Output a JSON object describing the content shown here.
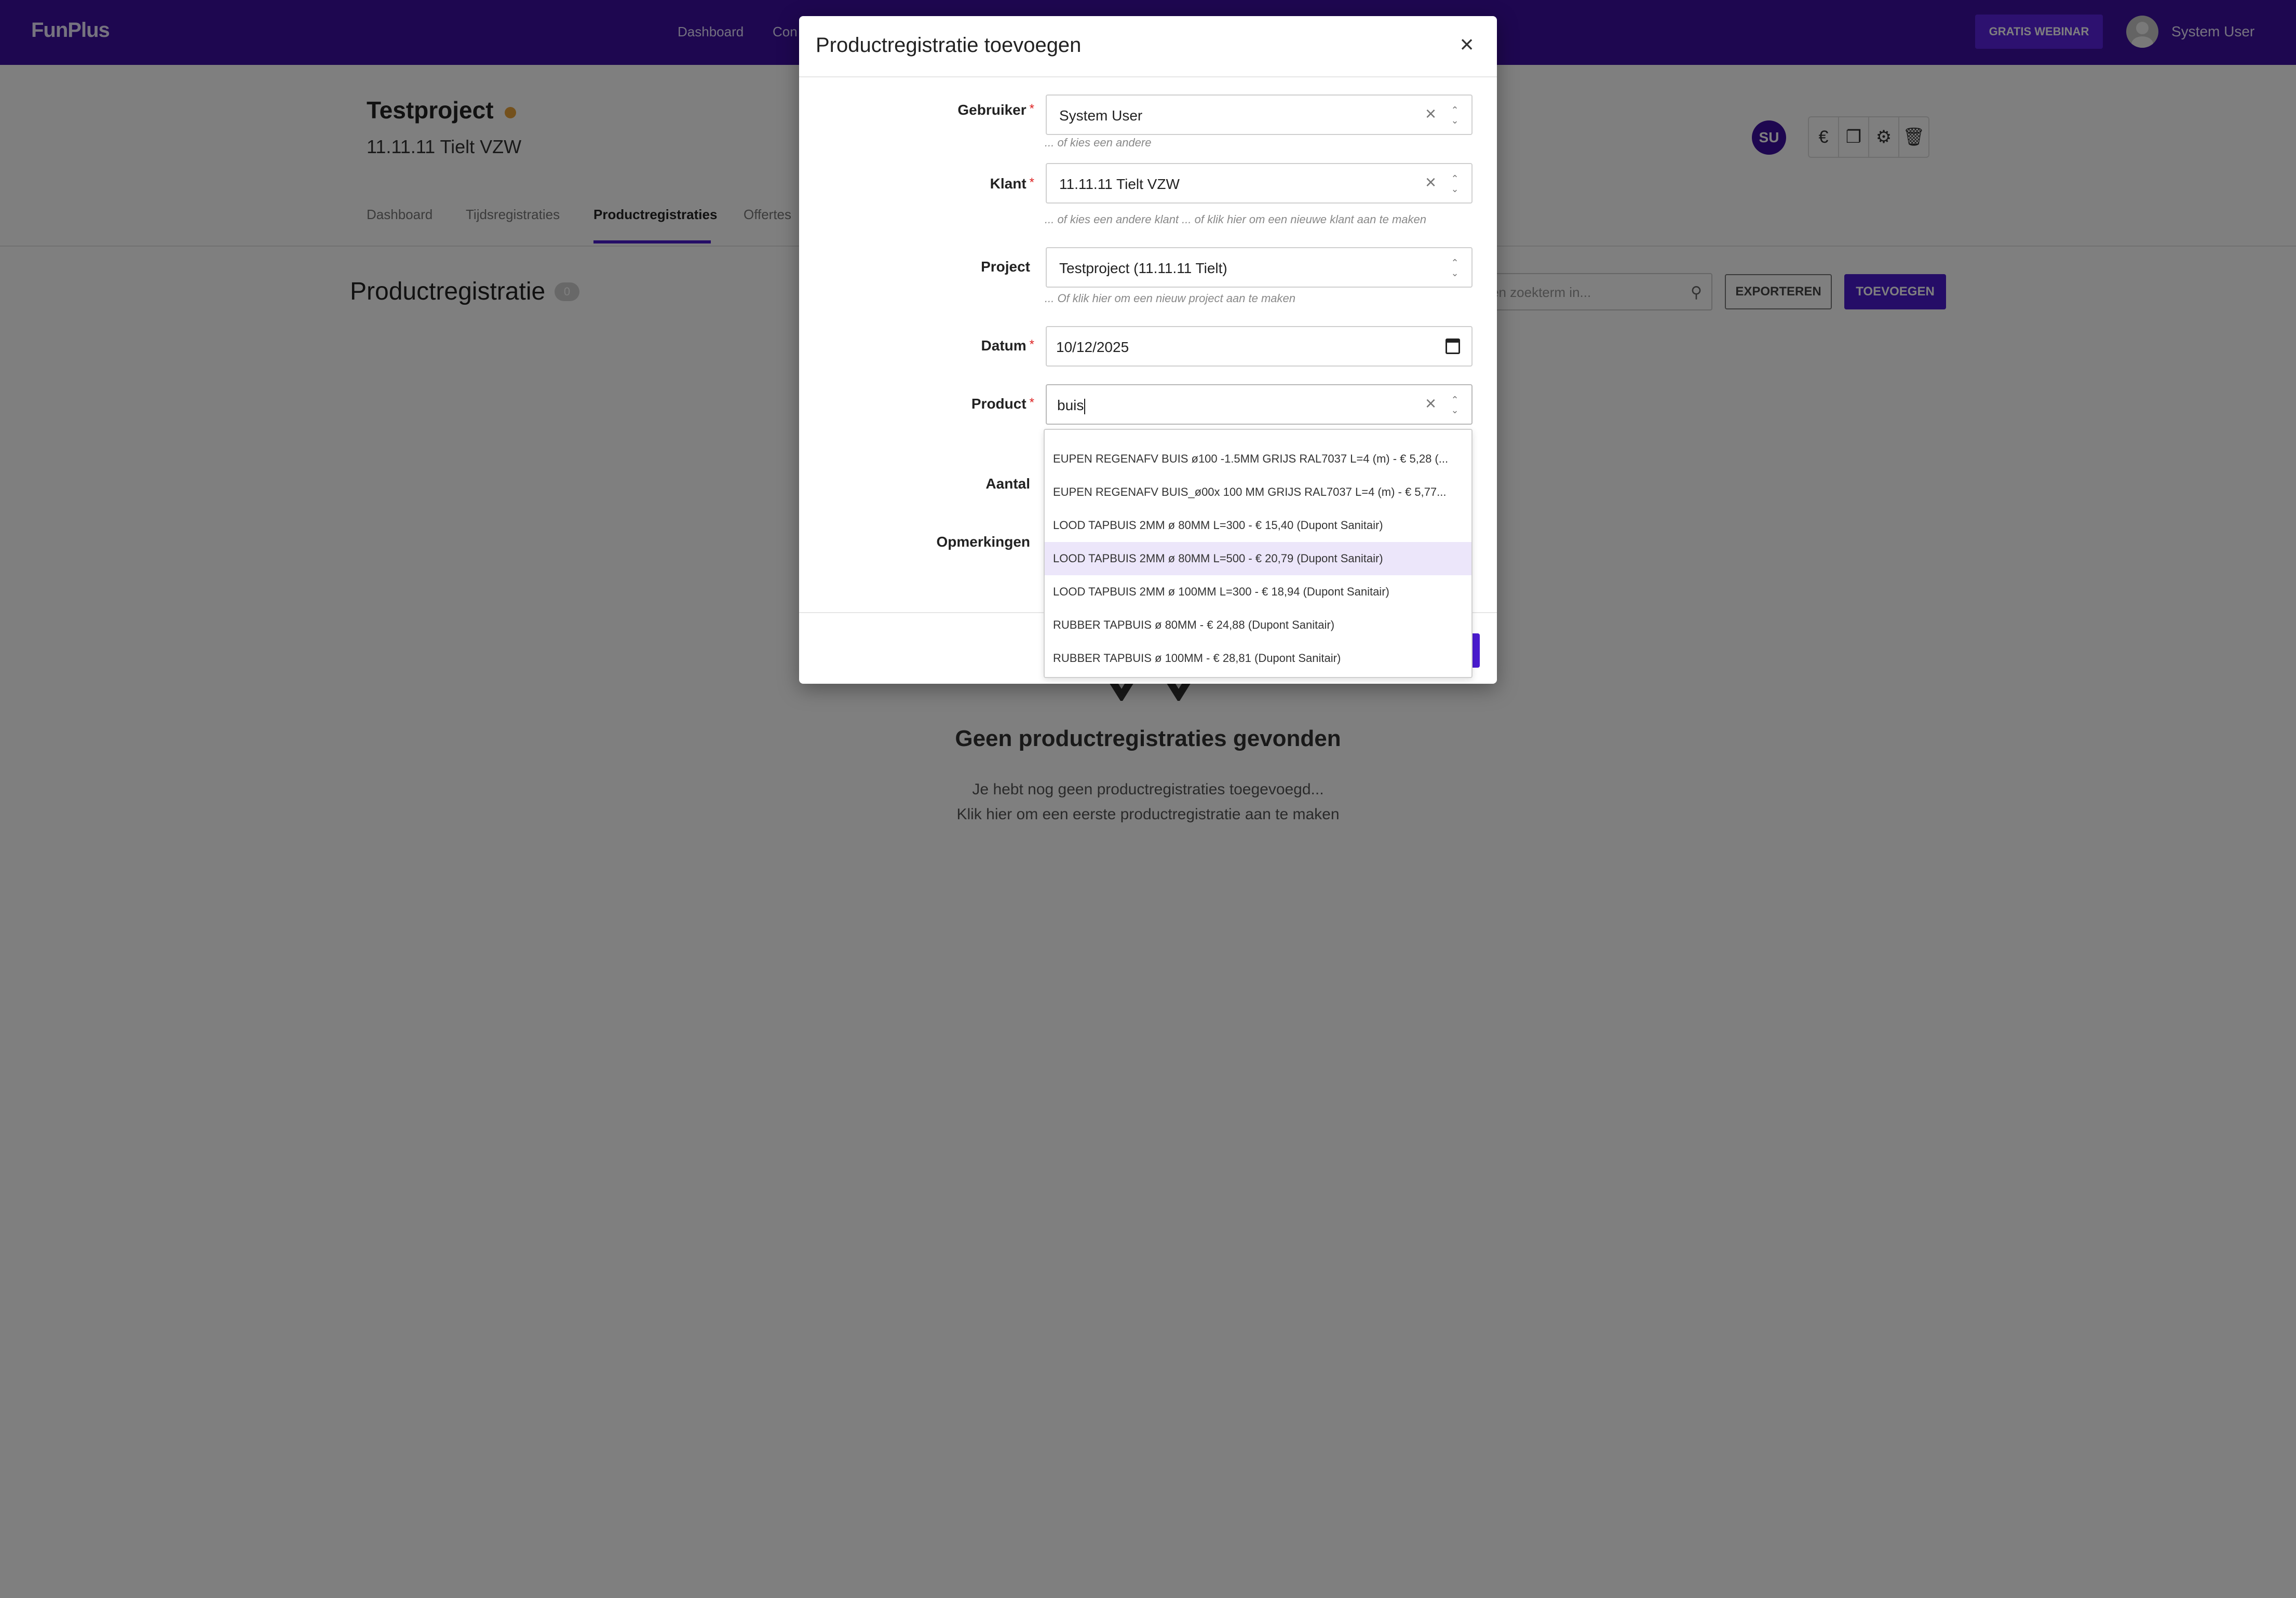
{
  "app": {
    "logo": "FunPlus",
    "nav": [
      "Dashboard",
      "Con"
    ],
    "webinar_label": "GRATIS WEBINAR",
    "user_name": "System User"
  },
  "project": {
    "title": "Testproject",
    "client": "11.11.11 Tielt VZW",
    "avatar_initials": "SU",
    "actions": [
      "euro-icon",
      "copy-icon",
      "gear-icon",
      "trash-icon"
    ]
  },
  "tabs": [
    {
      "label": "Dashboard",
      "active": false
    },
    {
      "label": "Tijdsregistraties",
      "active": false
    },
    {
      "label": "Productregistraties",
      "active": true
    },
    {
      "label": "Offertes",
      "active": false
    }
  ],
  "list": {
    "title": "Productregistratie",
    "count": "0",
    "search_placeholder": "en zoekterm in...",
    "export_label": "EXPORTEREN",
    "add_label": "TOEVOEGEN"
  },
  "empty": {
    "title": "Geen productregistraties gevonden",
    "line1": "Je hebt nog geen productregistraties toegevoegd...",
    "line2": "Klik hier om een eerste productregistratie aan te maken"
  },
  "modal": {
    "title": "Productregistratie toevoegen",
    "fields": {
      "gebruiker": {
        "label": "Gebruiker",
        "value": "System User",
        "help": "... of kies een andere"
      },
      "klant": {
        "label": "Klant",
        "value": "11.11.11 Tielt VZW",
        "help": "... of kies een andere klant ... of klik hier om een nieuwe klant aan te maken"
      },
      "project": {
        "label": "Project",
        "value": "Testproject (11.11.11 Tielt)",
        "help": "... Of klik hier om een nieuw project aan te maken"
      },
      "datum": {
        "label": "Datum",
        "value": "10/12/2025"
      },
      "product": {
        "label": "Product",
        "value": "buis"
      },
      "aantal": {
        "label": "Aantal"
      },
      "opmerkingen": {
        "label": "Opmerkingen"
      }
    },
    "dropdown_options": [
      "EUPEN REGENAFV BUIS ø100 -1.5MM GRIJS RAL7037 L=4 (m) - € 5,28 (...",
      "EUPEN REGENAFV BUIS_ø00x 100 MM GRIJS RAL7037 L=4 (m) - € 5,77...",
      "LOOD TAPBUIS 2MM ø 80MM L=300 - € 15,40 (Dupont Sanitair)",
      "LOOD TAPBUIS 2MM ø 80MM L=500 - € 20,79 (Dupont Sanitair)",
      "LOOD TAPBUIS 2MM ø 100MM L=300 - € 18,94 (Dupont Sanitair)",
      "RUBBER TAPBUIS ø 80MM - € 24,88 (Dupont Sanitair)",
      "RUBBER TAPBUIS ø 100MM - € 28,81 (Dupont Sanitair)"
    ],
    "highlighted_option_index": 3
  },
  "colors": {
    "brand": "#3c0fa0",
    "accent": "#4a1bcf",
    "status_dot": "#e8a33a",
    "highlight": "#ece6fa"
  }
}
